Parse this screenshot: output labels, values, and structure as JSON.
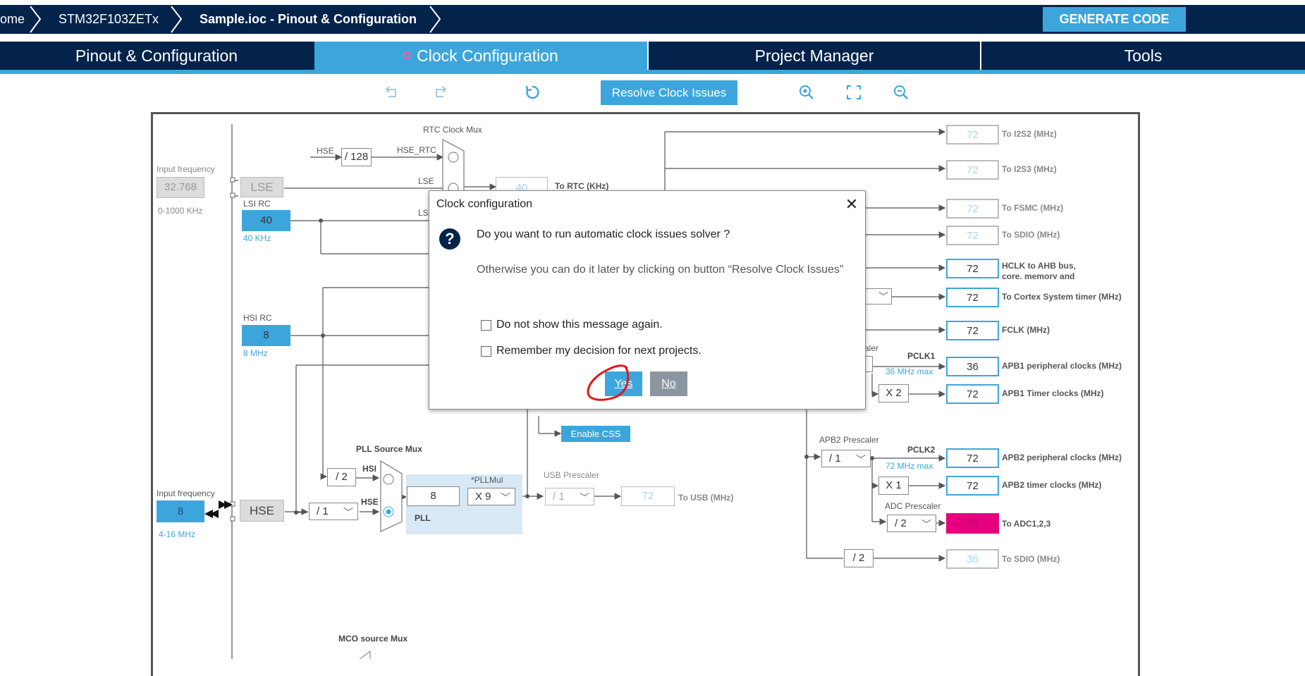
{
  "breadcrumb": {
    "home": "ome",
    "device": "STM32F103ZETx",
    "file": "Sample.ioc - Pinout & Configuration"
  },
  "generate_label": "GENERATE CODE",
  "tabs": [
    "Pinout & Configuration",
    "Clock Configuration",
    "Project Manager",
    "Tools"
  ],
  "toolbar": {
    "resolve_label": "Resolve Clock Issues",
    "icons": [
      "undo-icon",
      "redo-icon",
      "reset-icon",
      "zoom-in-icon",
      "fit-screen-icon",
      "zoom-out-icon"
    ]
  },
  "colors": {
    "brand_dark": "#03234b",
    "accent": "#3ca6dc",
    "error": "#e6007e"
  },
  "diagram": {
    "rtc_mux": "RTC Clock Mux",
    "hse_label": "HSE",
    "div128": "/ 128",
    "hse_rtc": "HSE_RTC",
    "lse_small": "LSE",
    "lsi_small": "LSI",
    "rtc_value": "40",
    "rtc_out": "To RTC (KHz)",
    "input_freq_label": "Input frequency",
    "lse_input": "32.768",
    "lse_range": "0-1000 KHz",
    "lse_box": "LSE",
    "lsi_rc": "LSI RC",
    "lsi_value": "40",
    "lsi_unit": "40 KHz",
    "hsi_rc": "HSI RC",
    "hsi_value": "8",
    "hsi_unit": "8 MHz",
    "pll_source_mux": "PLL Source Mux",
    "div2": "/ 2",
    "hsi_small": "HSI",
    "hse_small": "HSE",
    "pllmul_label": "*PLLMul",
    "pll_input": "8",
    "pll_mul": "X 9",
    "pll_label": "PLL",
    "usb_prescaler": "USB Prescaler",
    "usb_div": "/ 1",
    "usb_value": "72",
    "usb_out": "To USB (MHz)",
    "hse_input_label": "Input frequency",
    "hse_input": "8",
    "hse_range": "4-16 MHz",
    "hse_box": "HSE",
    "hse_div": "/ 1",
    "enable_css": "Enable CSS",
    "mco_label": "MCO source Mux",
    "prescaler_partial": "aler",
    "pclk1": "PCLK1",
    "pclk1_max": "36 MHz max",
    "apb1_timer_mul": "X 2",
    "apb2_prescaler": "APB2 Prescaler",
    "apb2_div": "/ 1",
    "pclk2": "PCLK2",
    "pclk2_max": "72 MHz max",
    "apb2_timer_mul": "X 1",
    "adc_prescaler": "ADC Prescaler",
    "adc_div": "/ 2",
    "sdio_div": "/ 2",
    "outputs": [
      {
        "value": "72",
        "label": "To I2S2 (MHz)",
        "dim": true
      },
      {
        "value": "72",
        "label": "To I2S3 (MHz)",
        "dim": true
      },
      {
        "value": "72",
        "label": "To FSMC (MHz)",
        "dim": true
      },
      {
        "value": "72",
        "label": "To SDIO (MHz)",
        "dim": true
      },
      {
        "value": "72",
        "label": "HCLK to AHB bus, core, memory and DMA (MHz)",
        "dim": false
      },
      {
        "value": "72",
        "label": "To Cortex System timer (MHz)",
        "dim": false
      },
      {
        "value": "72",
        "label": "FCLK (MHz)",
        "dim": false
      },
      {
        "value": "36",
        "label": "APB1 peripheral clocks (MHz)",
        "dim": false
      },
      {
        "value": "72",
        "label": "APB1 Timer clocks (MHz)",
        "dim": false
      },
      {
        "value": "72",
        "label": "APB2 peripheral clocks (MHz)",
        "dim": false
      },
      {
        "value": "72",
        "label": "APB2 timer clocks (MHz)",
        "dim": false
      },
      {
        "value": "36",
        "label": "To ADC1,2,3",
        "dim": false
      },
      {
        "value": "36",
        "label": "To SDIO (MHz)",
        "dim": true
      }
    ]
  },
  "dialog": {
    "title": "Clock configuration",
    "message": "Do you want to run automatic clock issues solver ?",
    "hint": "Otherwise you can do it later by clicking on button “Resolve Clock Issues”",
    "checkbox1": "Do not show this message again.",
    "checkbox2": "Remember my decision for next projects.",
    "yes": "Yes",
    "no": "No"
  }
}
